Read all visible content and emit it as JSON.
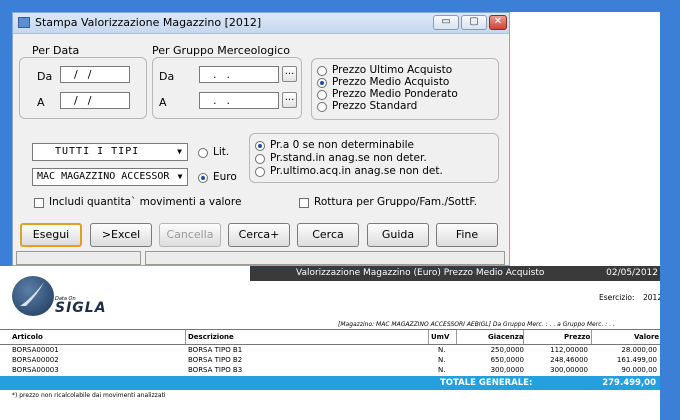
{
  "window": {
    "title": "Stampa Valorizzazione Magazzino [2012]",
    "minimize": "▭",
    "maximize": "▢",
    "close": "✕"
  },
  "per_data": {
    "legend": "Per Data",
    "da_label": "Da",
    "a_label": "A",
    "da_value": "  /  /",
    "a_value": "  /  /"
  },
  "per_gruppo": {
    "legend": "Per Gruppo Merceologico",
    "da_label": "Da",
    "a_label": "A",
    "da_value": "  .  .",
    "a_value": "  .  .",
    "lookup": "..."
  },
  "price_options": {
    "items": [
      {
        "label": "Prezzo Ultimo Acquisto",
        "selected": false
      },
      {
        "label": "Prezzo Medio Acquisto",
        "selected": true
      },
      {
        "label": "Prezzo Medio Ponderato",
        "selected": false
      },
      {
        "label": "Prezzo Standard",
        "selected": false
      }
    ]
  },
  "tipi_select": {
    "value": "TUTTI I TIPI"
  },
  "magazzino_select": {
    "value": "MAC MAGAZZINO ACCESSOR"
  },
  "currency": {
    "lit": "Lit.",
    "euro": "Euro",
    "selected": "Euro"
  },
  "fallback_options": {
    "items": [
      {
        "label": "Pr.a 0 se non determinabile",
        "selected": true
      },
      {
        "label": "Pr.stand.in anag.se non deter.",
        "selected": false
      },
      {
        "label": "Pr.ultimo.acq.in anag.se non det.",
        "selected": false
      }
    ]
  },
  "checks": {
    "includi": {
      "label": "Includi quantita` movimenti a valore",
      "checked": false
    },
    "rottura": {
      "label": "Rottura per Gruppo/Fam./SottF.",
      "checked": false
    }
  },
  "buttons": {
    "esegui": "Esegui",
    "excel": ">Excel",
    "cancella": "Cancella",
    "cerca_plus": "Cerca+",
    "cerca": "Cerca",
    "guida": "Guida",
    "fine": "Fine"
  },
  "report": {
    "header_title": "Valorizzazione Magazzino  (Euro) Prezzo Medio Acquisto",
    "header_date": "02/05/2012",
    "logo_small": "Data On",
    "logo_text": "SIGLA",
    "esercizio_label": "Esercizio:",
    "esercizio_value": "2012",
    "filter_line": "[Magazzino: MAC MAGAZZINO ACCESSORI AEBIGL]  Da Gruppo Merc. :    .    .       a Gruppo Merc. :    .    .",
    "columns": [
      "Articolo",
      "Descrizione",
      "UmV",
      "Giacenza",
      "Prezzo",
      "Valore"
    ],
    "rows": [
      {
        "articolo": "BORSA00001",
        "descrizione": "BORSA TIPO B1",
        "umv": "N.",
        "giacenza": "250,0000",
        "prezzo": "112,00000",
        "valore": "28.000,00"
      },
      {
        "articolo": "BORSA00002",
        "descrizione": "BORSA TIPO B2",
        "umv": "N.",
        "giacenza": "650,0000",
        "prezzo": "248,46000",
        "valore": "161.499,00"
      },
      {
        "articolo": "BORSA00003",
        "descrizione": "BORSA TIPO B3",
        "umv": "N.",
        "giacenza": "300,0000",
        "prezzo": "300,00000",
        "valore": "90.000,00"
      }
    ],
    "total_label": "TOTALE GENERALE:",
    "total_value": "279.499,00",
    "footnote": "*) prezzo non ricalcolabile dai movimenti analizzati"
  },
  "colors": {
    "background": "#3b7fd6",
    "total_bar": "#24a0e0",
    "report_header": "#3a3a3a",
    "focus_border": "#e0a020"
  }
}
